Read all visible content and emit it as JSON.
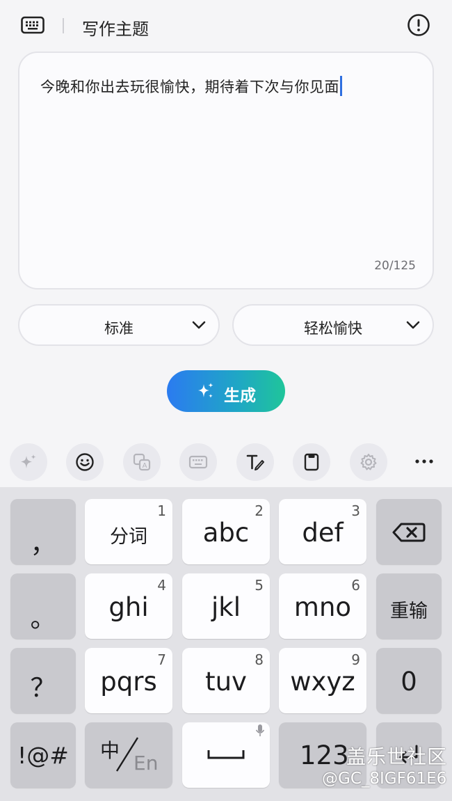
{
  "header": {
    "title": "写作主题",
    "keyboard_icon": "keyboard-icon",
    "info_icon": "info-icon"
  },
  "editor": {
    "text": "今晚和你出去玩很愉快，期待着下次与你见面",
    "counter": "20/125"
  },
  "options": {
    "length": "标准",
    "tone": "轻松愉快"
  },
  "generate": {
    "label": "生成",
    "icon": "sparkle-icon"
  },
  "toolbar": {
    "items": [
      "ai-sparkle-icon",
      "emoji-icon",
      "translate-icon",
      "keyboard-layout-icon",
      "handwriting-icon",
      "clipboard-icon",
      "settings-icon",
      "more-icon"
    ]
  },
  "keyboard": {
    "comma": "，",
    "period": "。",
    "question": "？",
    "symbols": "!@#",
    "rows": [
      [
        {
          "label": "分词",
          "num": "1"
        },
        {
          "label": "abc",
          "num": "2"
        },
        {
          "label": "def",
          "num": "3"
        }
      ],
      [
        {
          "label": "ghi",
          "num": "4"
        },
        {
          "label": "jkl",
          "num": "5"
        },
        {
          "label": "mno",
          "num": "6"
        }
      ],
      [
        {
          "label": "pqrs",
          "num": "7"
        },
        {
          "label": "tuv",
          "num": "8"
        },
        {
          "label": "wxyz",
          "num": "9"
        }
      ]
    ],
    "reenter": "重输",
    "zero": "0",
    "lang_zh": "中",
    "lang_en": "En",
    "num_mode": "123"
  },
  "watermark": {
    "line1": "盖乐世社区",
    "line2": "@GC_8IGF61E6"
  },
  "colors": {
    "accent": "#2f6fe0",
    "gradient_start": "#2b7bf0",
    "gradient_end": "#1fc59a"
  }
}
